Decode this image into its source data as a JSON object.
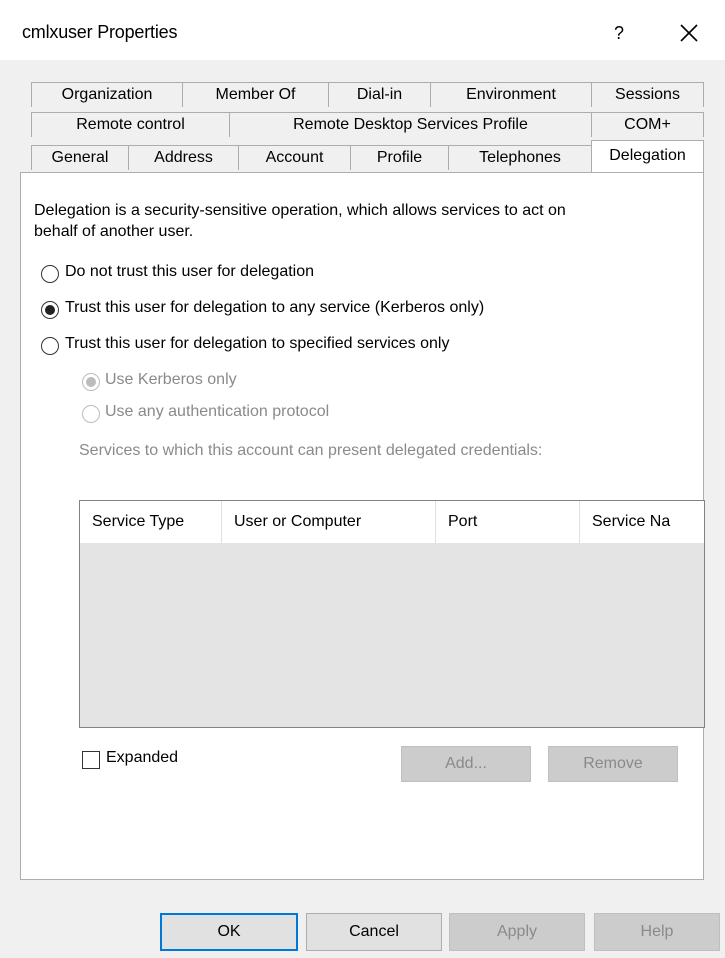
{
  "window": {
    "title": "cmlxuser Properties",
    "help_label": "?",
    "close_icon": "close-icon"
  },
  "tabs": {
    "row1": [
      "Organization",
      "Member Of",
      "Dial-in",
      "Environment",
      "Sessions"
    ],
    "row2": [
      "Remote control",
      "Remote Desktop Services Profile",
      "COM+"
    ],
    "row3": [
      "General",
      "Address",
      "Account",
      "Profile",
      "Telephones",
      "Delegation"
    ],
    "selected": "Delegation"
  },
  "delegation": {
    "description_line1": "Delegation is a security-sensitive operation, which allows services to act on",
    "description_line2": "behalf of another user.",
    "options": [
      {
        "label": "Do not trust this user for delegation",
        "checked": false
      },
      {
        "label": "Trust this user for delegation to any service (Kerberos only)",
        "checked": true
      },
      {
        "label": "Trust this user for delegation to specified services only",
        "checked": false
      }
    ],
    "sub_options": [
      {
        "label": "Use Kerberos only",
        "checked": true,
        "enabled": false
      },
      {
        "label": "Use any authentication protocol",
        "checked": false,
        "enabled": false
      }
    ],
    "services_label": "Services to which this account can present delegated credentials:",
    "columns": [
      "Service Type",
      "User or Computer",
      "Port",
      "Service Na"
    ],
    "expanded_label": "Expanded",
    "expanded_checked": false,
    "add_label": "Add...",
    "remove_label": "Remove"
  },
  "footer": {
    "ok_label": "OK",
    "cancel_label": "Cancel",
    "apply_label": "Apply",
    "help_label": "Help"
  },
  "colors": {
    "dialog_bg": "#f0f0f0",
    "default_button_border": "#0078d7",
    "disabled_text": "#8a8a8a"
  }
}
